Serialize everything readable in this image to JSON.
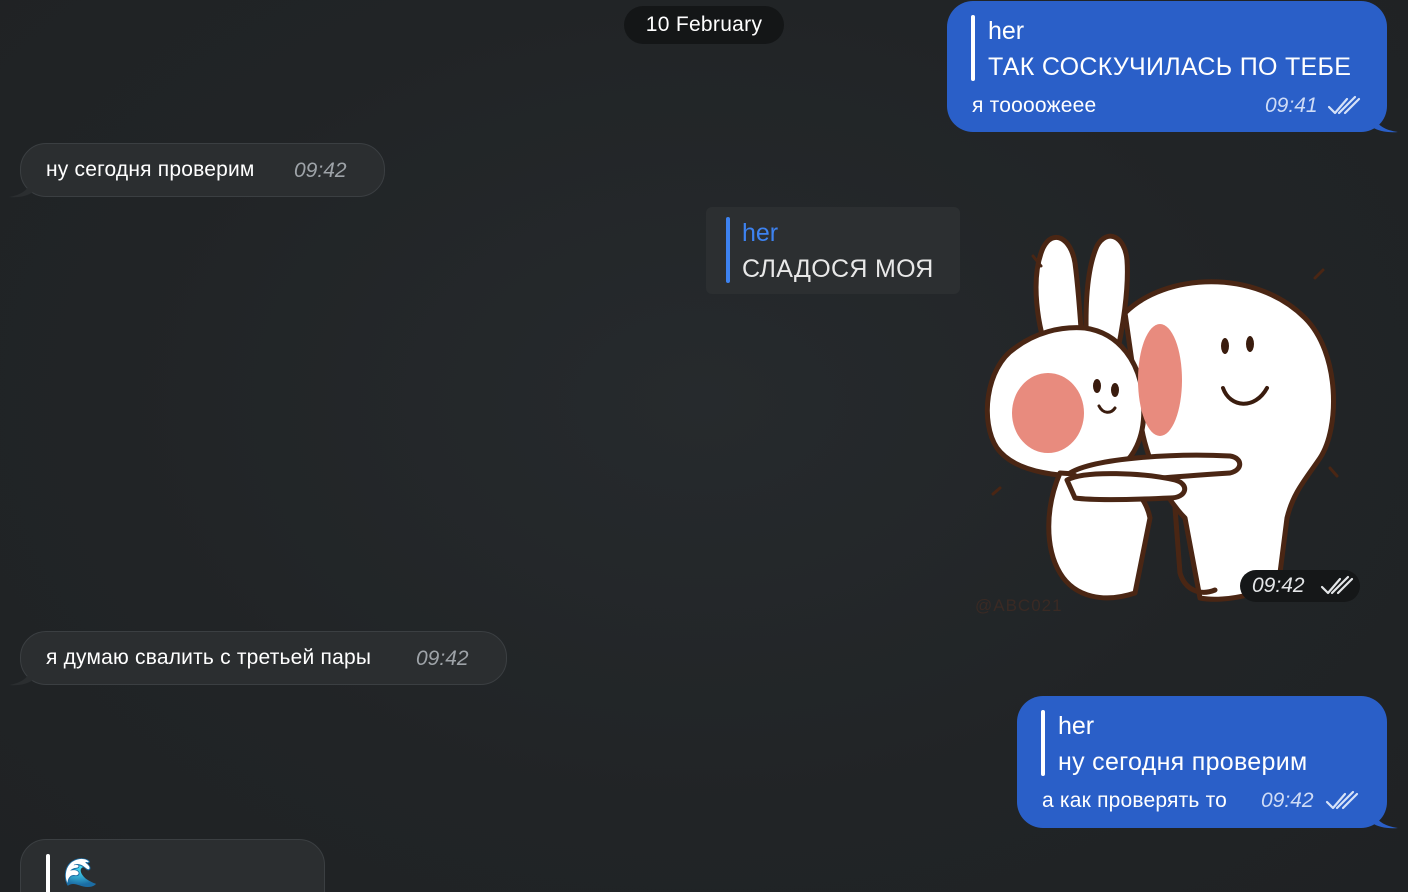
{
  "date_separator": "10 February",
  "messages": [
    {
      "id": "m1",
      "direction": "outgoing",
      "reply_to_name": "her",
      "reply_to_text": "ТАК СОСКУЧИЛАСЬ ПО ТЕБЕ",
      "text": "я тоооожеее",
      "time": "09:41",
      "status": "read"
    },
    {
      "id": "m2",
      "direction": "incoming",
      "text": "ну сегодня проверим",
      "time": "09:42"
    },
    {
      "id": "m3",
      "direction": "outgoing",
      "type": "sticker",
      "reply_to_name": "her",
      "reply_to_text": "СЛАДОСЯ МОЯ",
      "sticker_watermark": "@ABC021",
      "time": "09:42",
      "status": "read"
    },
    {
      "id": "m4",
      "direction": "incoming",
      "text": "я думаю свалить с третьей пары",
      "time": "09:42"
    },
    {
      "id": "m5",
      "direction": "outgoing",
      "reply_to_name": "her",
      "reply_to_text": "ну сегодня проверим",
      "text": "а как проверять то",
      "time": "09:42",
      "status": "read"
    },
    {
      "id": "m6",
      "direction": "incoming",
      "reply_to_emoji": "🌊"
    }
  ],
  "colors": {
    "background": "#212426",
    "incoming_bubble": "#2b2e30",
    "outgoing_bubble": "#2a5fc8",
    "reply_name_accent": "#3d82f0",
    "date_pill": "#141617"
  },
  "icons": {
    "read_status": "double-check-icon"
  }
}
